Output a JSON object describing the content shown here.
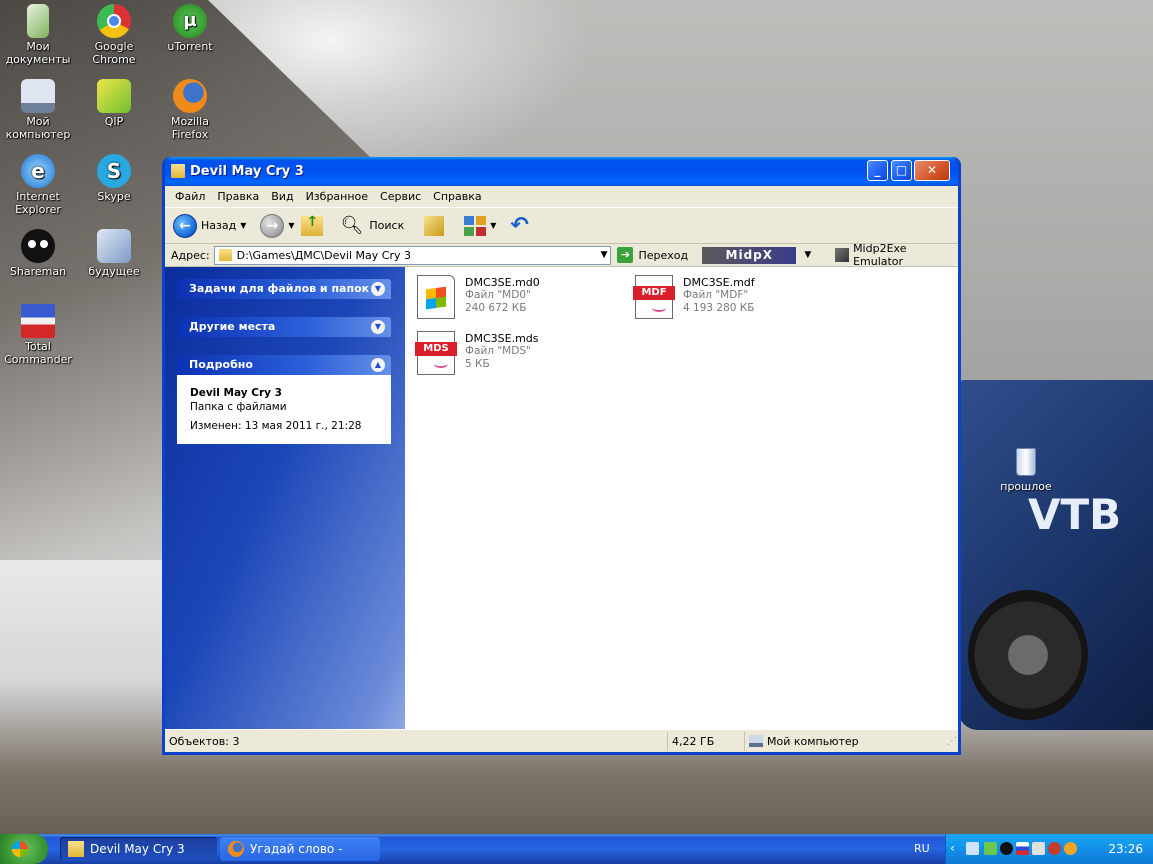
{
  "desktop": {
    "icons": [
      {
        "label": "Мои документы",
        "icon": "my-documents-icon"
      },
      {
        "label": "Google Chrome",
        "icon": "chrome-icon"
      },
      {
        "label": "uTorrent",
        "icon": "utorrent-icon"
      },
      {
        "label": "Мой компьютер",
        "icon": "my-computer-icon"
      },
      {
        "label": "QIP",
        "icon": "qip-icon"
      },
      {
        "label": "Mozilla Firefox",
        "icon": "firefox-icon"
      },
      {
        "label": "Internet Explorer",
        "icon": "internet-explorer-icon"
      },
      {
        "label": "Skype",
        "icon": "skype-icon"
      },
      {
        "label": "Shareman",
        "icon": "shareman-icon"
      },
      {
        "label": "будущее",
        "icon": "network-folder-icon"
      },
      {
        "label": "Total Commander",
        "icon": "total-commander-icon"
      },
      {
        "label": "прошлое",
        "icon": "recycle-bin-icon"
      }
    ]
  },
  "window": {
    "title": "Devil May Cry 3",
    "menu": [
      "Файл",
      "Правка",
      "Вид",
      "Избранное",
      "Сервис",
      "Справка"
    ],
    "toolbar": {
      "back_label": "Назад",
      "search_label": "Поиск"
    },
    "address": {
      "label": "Адрес:",
      "value": "D:\\Games\\ДМС\\Devil May Cry 3",
      "go_label": "Переход",
      "midp_label": "MidpX",
      "emulator_label": "Midp2Exe Emulator"
    },
    "taskpane": {
      "file_tasks": "Задачи для файлов и папок",
      "other_places": "Другие места",
      "details": "Подробно",
      "details_name": "Devil May Cry 3",
      "details_type": "Папка с файлами",
      "details_modified": "Изменен: 13 мая 2011 г., 21:28"
    },
    "files": [
      {
        "name": "DMC3SE.md0",
        "type": "Файл \"MD0\"",
        "size": "240 672 КБ",
        "icon": "windows-file-icon"
      },
      {
        "name": "DMC3SE.mdf",
        "type": "Файл \"MDF\"",
        "size": "4 193 280 КБ",
        "icon": "mdf-file-icon",
        "badge": "MDF"
      },
      {
        "name": "DMC3SE.mds",
        "type": "Файл \"MDS\"",
        "size": "5 КБ",
        "icon": "mds-file-icon",
        "badge": "MDS"
      }
    ],
    "status": {
      "objects": "Объектов: 3",
      "size": "4,22 ГБ",
      "location": "Мой компьютер"
    }
  },
  "taskbar": {
    "tasks": [
      {
        "label": "Devil May Cry 3",
        "active": true
      },
      {
        "label": "Угадай слово - Mozi...",
        "active": false
      }
    ],
    "lang": "RU",
    "time": "23:26"
  },
  "colors": {
    "xp_blue": "#0050ee",
    "taskbar_blue": "#2663e0",
    "start_green": "#3c9a35"
  }
}
